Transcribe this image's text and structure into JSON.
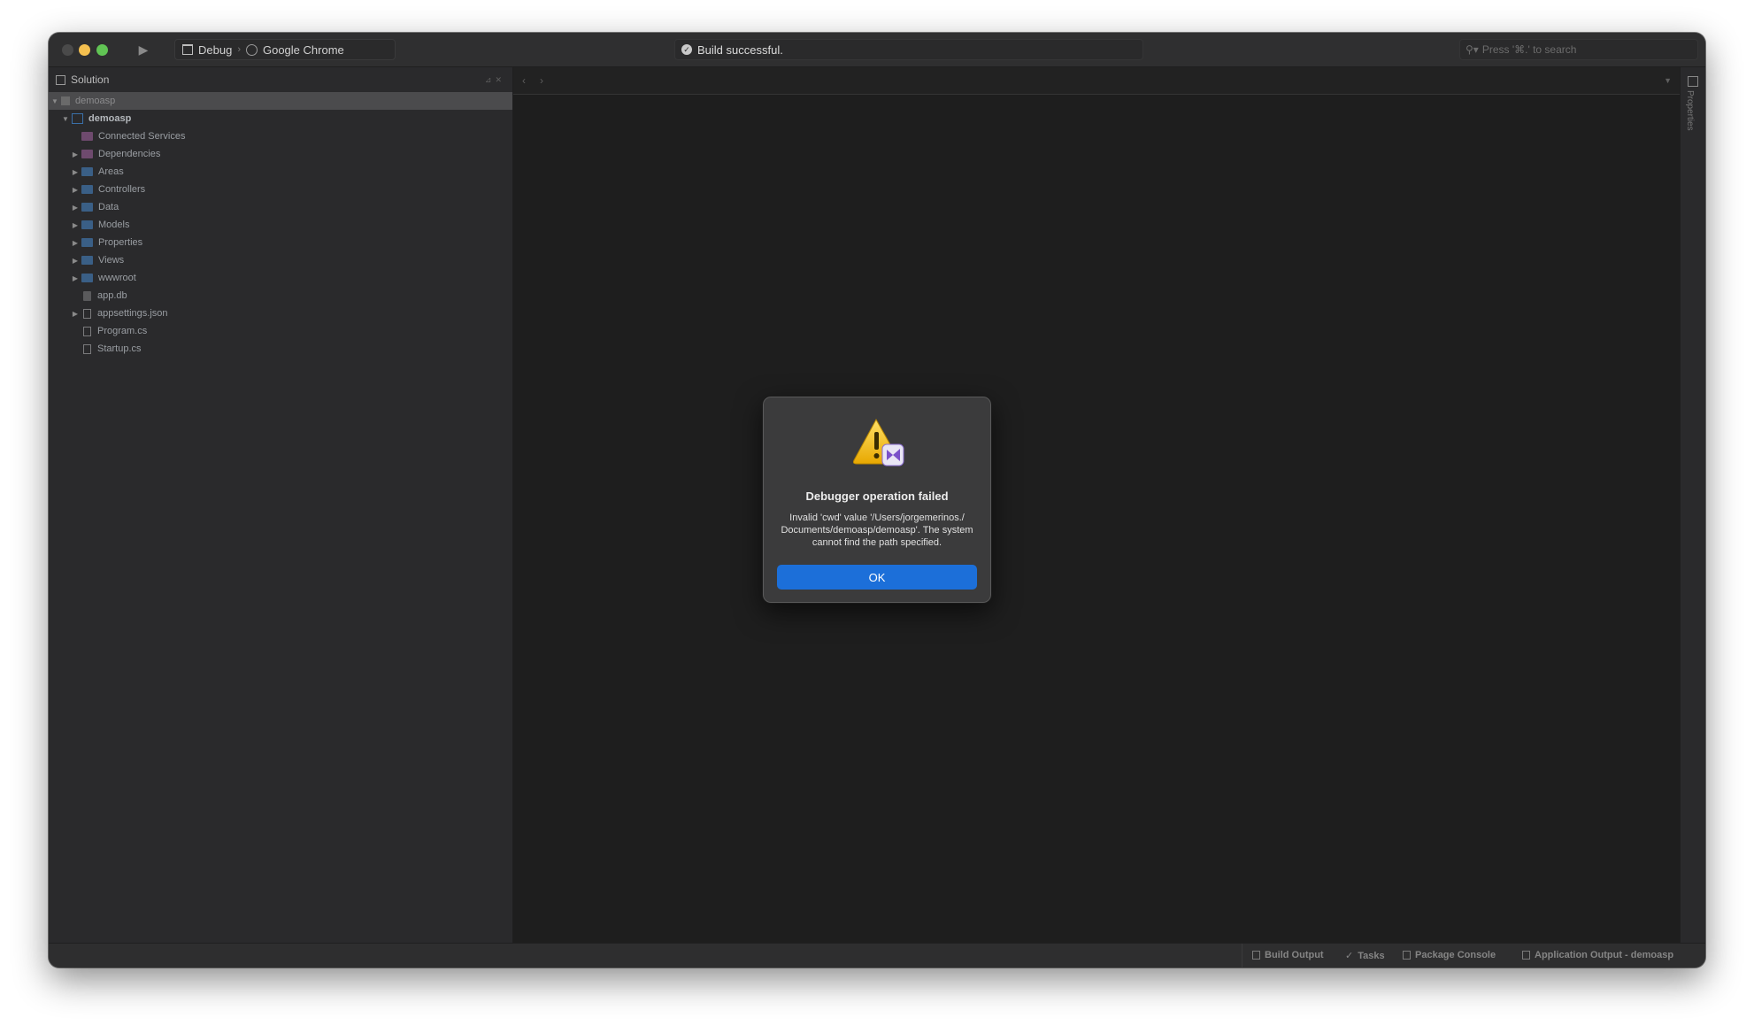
{
  "toolbar": {
    "run_icon": "play-icon",
    "configuration": "Debug",
    "target": "Google Chrome",
    "status": "Build successful.",
    "search_placeholder": "Press '⌘.' to search"
  },
  "sidebar": {
    "header": "Solution",
    "solution_name": "demoasp",
    "project_name": "demoasp",
    "items": [
      {
        "label": "Connected Services",
        "icon": "connected-services-icon",
        "expandable": false
      },
      {
        "label": "Dependencies",
        "icon": "dependencies-icon",
        "expandable": true
      },
      {
        "label": "Areas",
        "icon": "folder-icon",
        "expandable": true
      },
      {
        "label": "Controllers",
        "icon": "folder-icon",
        "expandable": true
      },
      {
        "label": "Data",
        "icon": "folder-icon",
        "expandable": true
      },
      {
        "label": "Models",
        "icon": "folder-icon",
        "expandable": true
      },
      {
        "label": "Properties",
        "icon": "folder-icon",
        "expandable": true
      },
      {
        "label": "Views",
        "icon": "folder-icon",
        "expandable": true
      },
      {
        "label": "wwwroot",
        "icon": "folder-icon",
        "expandable": true
      },
      {
        "label": "app.db",
        "icon": "file-icon",
        "expandable": false
      },
      {
        "label": "appsettings.json",
        "icon": "json-file-icon",
        "expandable": true
      },
      {
        "label": "Program.cs",
        "icon": "cs-file-icon",
        "expandable": false
      },
      {
        "label": "Startup.cs",
        "icon": "cs-file-icon",
        "expandable": false
      }
    ]
  },
  "right_panel": {
    "label": "Properties"
  },
  "bottom_pads": {
    "build_output": "Build Output",
    "tasks": "Tasks",
    "package_console": "Package Console",
    "application_output": "Application Output - demoasp"
  },
  "dialog": {
    "title": "Debugger operation failed",
    "message": "Invalid 'cwd' value '/Users/jorgemerinos./ Documents/demoasp/demoasp'. The system cannot find the path specified.",
    "ok_label": "OK"
  },
  "colors": {
    "accent": "#1c6fd9",
    "folder": "#3a5f86",
    "editor_bg": "#1e1e1e"
  }
}
